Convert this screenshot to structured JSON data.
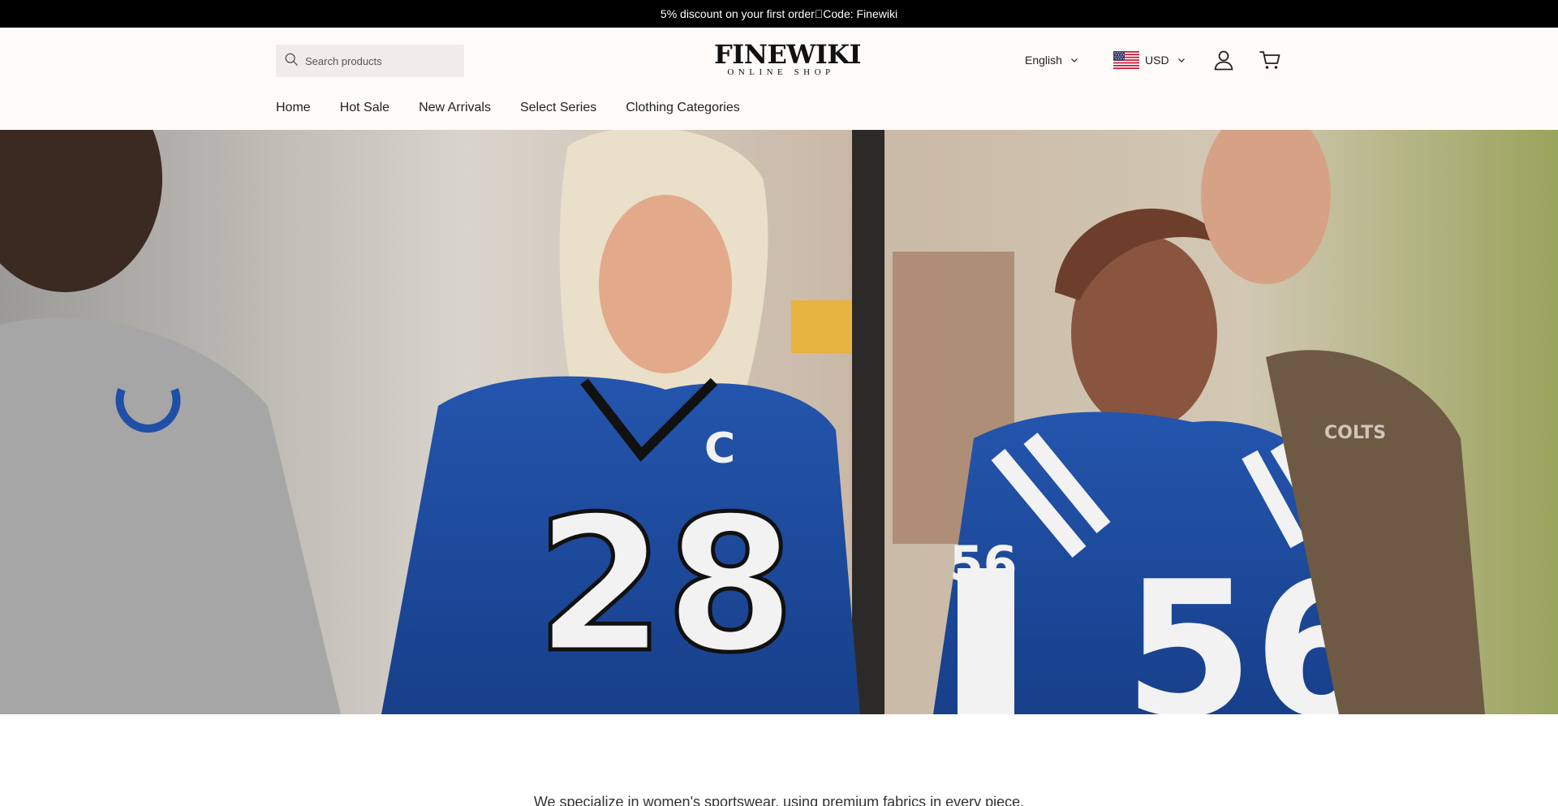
{
  "announcement": {
    "text": "5% discount on your first order\u0000Code: Finewiki"
  },
  "header": {
    "search": {
      "placeholder": "Search products"
    },
    "logo": {
      "brand": "FINEWIKI",
      "tagline": "ONLINE SHOP"
    },
    "language": {
      "selected": "English"
    },
    "currency": {
      "selected": "USD",
      "flag": "us-flag"
    }
  },
  "nav": {
    "items": [
      {
        "label": "Home"
      },
      {
        "label": "Hot Sale"
      },
      {
        "label": "New Arrivals"
      },
      {
        "label": "Select Series"
      },
      {
        "label": "Clothing Categories"
      }
    ]
  },
  "hero": {
    "jersey_number_left": "28",
    "jersey_number_right": "56",
    "sleeve_number": "56",
    "captain_patch": "C",
    "shirt_text": "COLTS",
    "jersey_color": "#1f4fa6"
  },
  "intro": {
    "text": "We specialize in women's sportswear, using premium fabrics in every piece."
  }
}
